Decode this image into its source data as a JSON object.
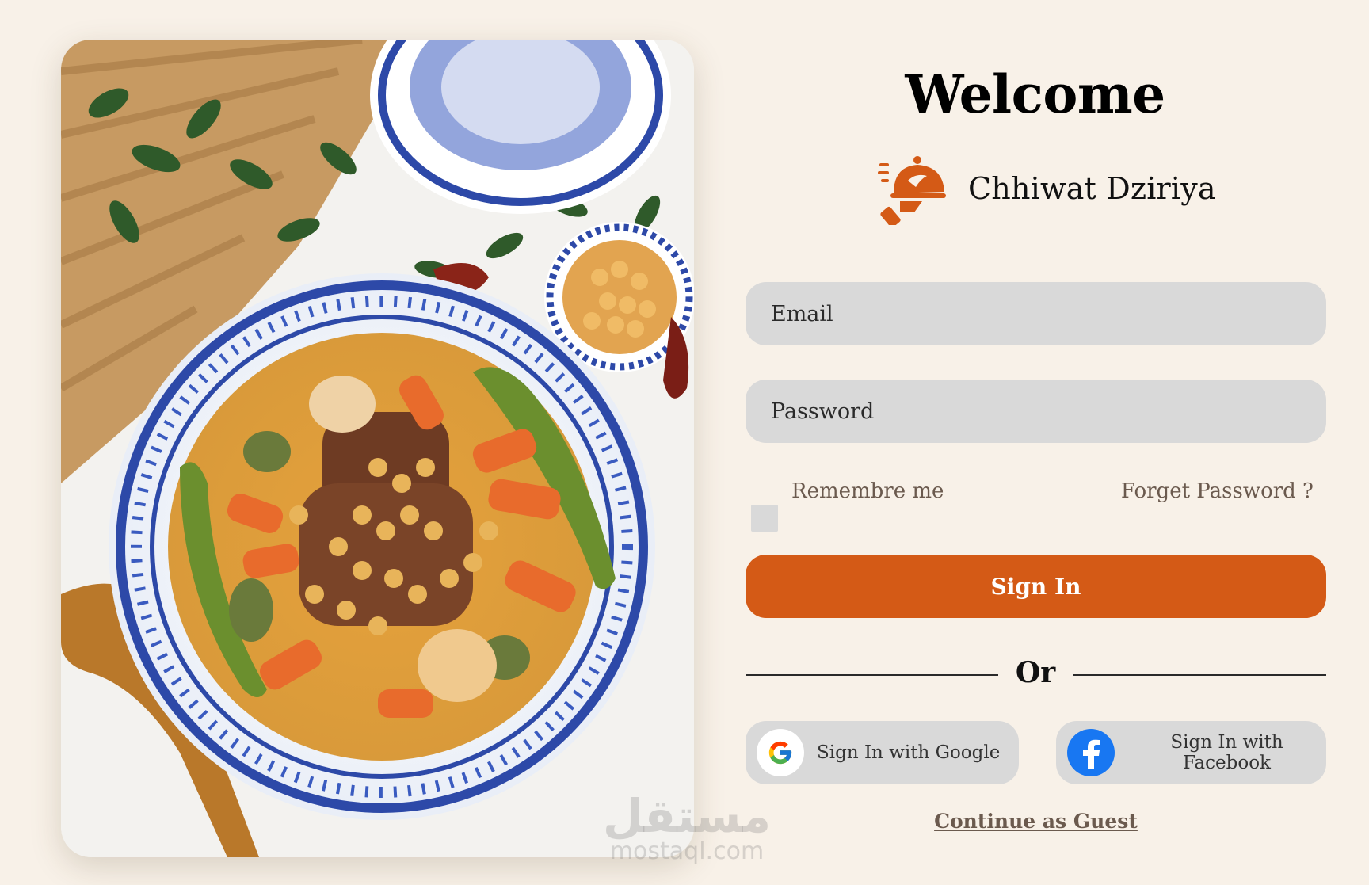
{
  "page": {
    "title": "Welcome",
    "brand_name": "Chhiwat Dziriya",
    "accent_color": "#d45a16",
    "background_color": "#f8f1e8",
    "field_color": "#d9d9d9"
  },
  "hero": {
    "icon": "couscous-dish-photo"
  },
  "brand": {
    "icon": "food-delivery-cloche-icon"
  },
  "form": {
    "email_placeholder": "Email",
    "password_placeholder": "Password",
    "remember_label": "Remembre me",
    "remember_checked": false,
    "forgot_label": "Forget Password ?",
    "signin_label": "Sign In",
    "or_label": "Or",
    "google_label": "Sign In with Google",
    "google_icon": "google-icon",
    "facebook_label": "Sign In with Facebook",
    "facebook_icon": "facebook-icon",
    "guest_label": "Continue as Guest"
  },
  "watermark": {
    "arabic": "مستقل",
    "latin": "mostaql.com"
  }
}
